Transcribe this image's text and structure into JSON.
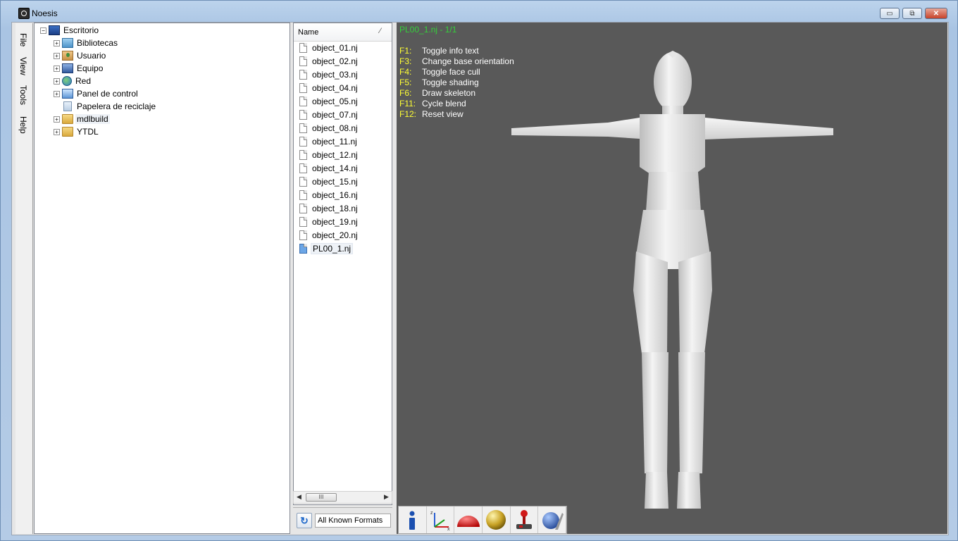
{
  "window": {
    "title": "Noesis",
    "controls": {
      "minimize": "▭",
      "maximize": "⧉",
      "close": "✕"
    }
  },
  "sidebar_tabs": [
    "File",
    "View",
    "Tools",
    "Help"
  ],
  "tree": {
    "root": "Escritorio",
    "items": [
      {
        "label": "Bibliotecas",
        "icon": "libraries-icon"
      },
      {
        "label": "Usuario",
        "icon": "user-folder-icon"
      },
      {
        "label": "Equipo",
        "icon": "computer-icon"
      },
      {
        "label": "Red",
        "icon": "network-icon"
      },
      {
        "label": "Panel de control",
        "icon": "control-panel-icon"
      },
      {
        "label": "Papelera de reciclaje",
        "icon": "recycle-bin-icon"
      },
      {
        "label": "mdlbuild",
        "icon": "folder-icon"
      },
      {
        "label": "YTDL",
        "icon": "folder-icon"
      }
    ]
  },
  "file_list": {
    "header": "Name",
    "sort_indicator": "⁄",
    "files": [
      "object_01.nj",
      "object_02.nj",
      "object_03.nj",
      "object_04.nj",
      "object_05.nj",
      "object_07.nj",
      "object_08.nj",
      "object_11.nj",
      "object_12.nj",
      "object_14.nj",
      "object_15.nj",
      "object_16.nj",
      "object_18.nj",
      "object_19.nj",
      "object_20.nj",
      "PL00_1.nj"
    ],
    "selected": "PL00_1.nj",
    "scroll_thumb": "III",
    "format_filter": "All Known Formats"
  },
  "viewport": {
    "title": "PL00_1.nj - 1/1",
    "keys": [
      {
        "key": "F1:",
        "desc": "Toggle info text"
      },
      {
        "key": "F3:",
        "desc": "Change base orientation"
      },
      {
        "key": "F4:",
        "desc": "Toggle face cull"
      },
      {
        "key": "F5:",
        "desc": "Toggle shading"
      },
      {
        "key": "F6:",
        "desc": "Draw skeleton"
      },
      {
        "key": "F11:",
        "desc": "Cycle blend"
      },
      {
        "key": "F12:",
        "desc": "Reset view"
      }
    ]
  },
  "toolbar": {
    "buttons": [
      "info-icon",
      "axis-icon",
      "dome-icon",
      "sphere-icon",
      "joystick-icon",
      "globe-wand-icon"
    ]
  },
  "colors": {
    "viewport_bg": "#595959",
    "title_green": "#34d03a",
    "key_yellow": "#ffff33"
  }
}
